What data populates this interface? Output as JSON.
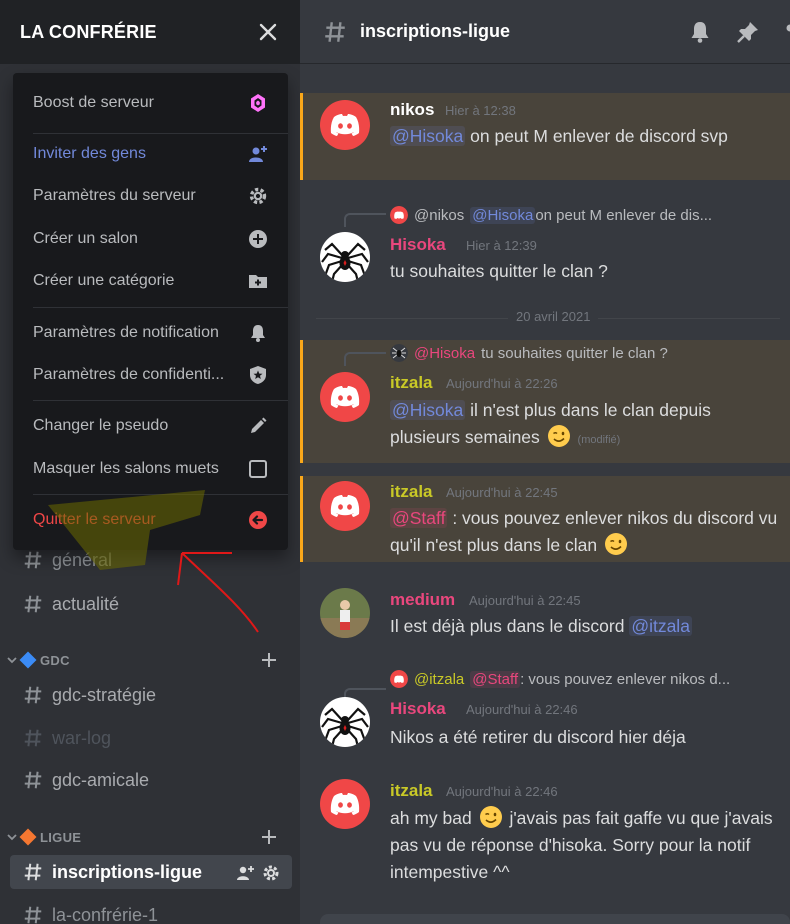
{
  "server": {
    "name": "LA CONFRÉRIE"
  },
  "menu": {
    "items": [
      {
        "label": "Boost de serveur",
        "icon": "boost-icon"
      },
      {
        "label": "Inviter des gens",
        "icon": "add-person-icon"
      },
      {
        "label": "Paramètres du serveur",
        "icon": "gear-icon"
      },
      {
        "label": "Créer un salon",
        "icon": "plus-circle-icon"
      },
      {
        "label": "Créer une catégorie",
        "icon": "folder-plus-icon"
      },
      {
        "label": "Paramètres de notification",
        "icon": "bell-icon"
      },
      {
        "label": "Paramètres de confidenti...",
        "icon": "shield-star-icon"
      },
      {
        "label": "Changer le pseudo",
        "icon": "pencil-icon"
      },
      {
        "label": "Masquer les salons muets",
        "icon": "checkbox-icon"
      },
      {
        "label": "Quitter le serveur",
        "icon": "leave-icon"
      }
    ]
  },
  "sidebar": {
    "channels_top": [
      {
        "name": "général"
      },
      {
        "name": "actualité"
      }
    ],
    "categories": [
      {
        "name": "GDC",
        "color": "#3b8bf6",
        "channels": [
          {
            "name": "gdc-stratégie"
          },
          {
            "name": "war-log"
          },
          {
            "name": "gdc-amicale"
          }
        ]
      },
      {
        "name": "LIGUE",
        "color": "#f57731",
        "channels": [
          {
            "name": "inscriptions-ligue"
          },
          {
            "name": "la-confrérie-1"
          }
        ]
      }
    ]
  },
  "channel": {
    "title": "inscriptions-ligue"
  },
  "date_divider": "20 avril 2021",
  "messages": [
    {
      "author": "nikos",
      "author_color": "#ffffff",
      "time": "Hier à 12:38",
      "mention": "@Hisoka",
      "text": " on peut M enlever de discord svp"
    },
    {
      "reply_author": "@nikos",
      "reply_mention": "@Hisoka",
      "reply_text": " on peut M enlever de dis...",
      "author": "Hisoka",
      "author_color": "#e9477d",
      "time": "Hier à 12:39",
      "text": "tu souhaites quitter le clan ?"
    },
    {
      "reply_author": "@Hisoka",
      "reply_text": " tu souhaites quitter le clan ?",
      "author": "itzala",
      "author_color": "#c9c927",
      "time": "Aujourd'hui à 22:26",
      "mention": "@Hisoka",
      "text": " il n'est plus dans le clan depuis plusieurs semaines",
      "edited": "(modifié)"
    },
    {
      "author": "itzala",
      "author_color": "#c9c927",
      "time": "Aujourd'hui à 22:45",
      "mention": "@Staff",
      "text": " : vous pouvez enlever nikos du discord vu qu'il n'est plus dans le clan"
    },
    {
      "author": "medium",
      "author_color": "#e9477d",
      "time": "Aujourd'hui à 22:45",
      "text": "Il est déjà plus dans le discord ",
      "mention": "@itzala"
    },
    {
      "reply_author": "@itzala",
      "reply_mention": "@Staff",
      "reply_text": " : vous pouvez enlever nikos d...",
      "author": "Hisoka",
      "author_color": "#e9477d",
      "time": "Aujourd'hui à 22:46",
      "text": "Nikos a été retirer du discord hier déja"
    },
    {
      "author": "itzala",
      "author_color": "#c9c927",
      "time": "Aujourd'hui à 22:46",
      "text_a": "ah my bad ",
      "text_b": " j'avais pas fait gaffe vu que j'avais pas vu de réponse d'hisoka. Sorry pour la notif intempestive ^^"
    }
  ]
}
